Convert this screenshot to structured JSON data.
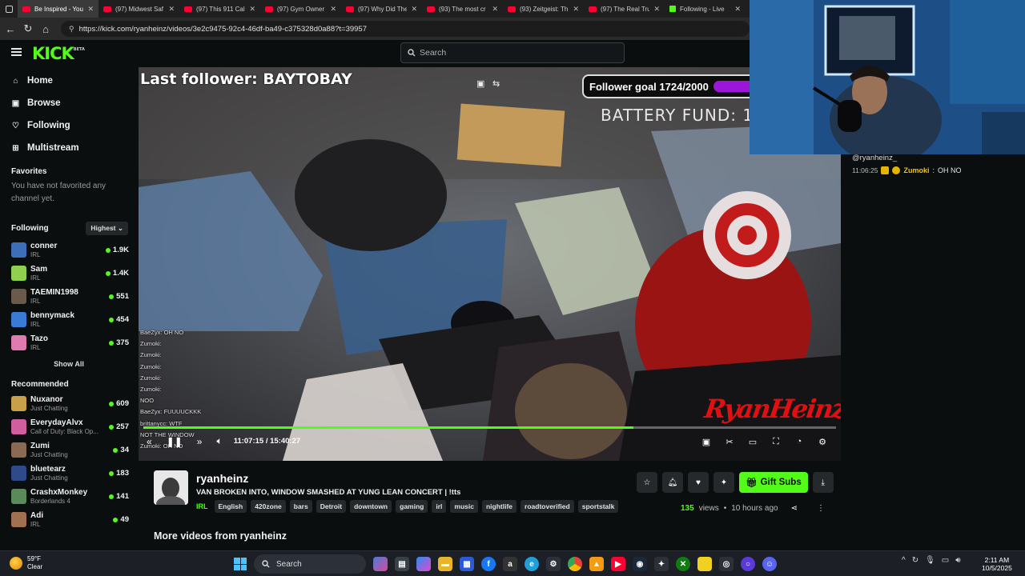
{
  "browser": {
    "tabs": [
      {
        "title": "Be Inspired - You",
        "icon": "youtube",
        "active": true
      },
      {
        "title": "(97) Midwest Saf",
        "icon": "youtube"
      },
      {
        "title": "(97) This 911 Cal",
        "icon": "youtube"
      },
      {
        "title": "(97) Gym Owner",
        "icon": "youtube"
      },
      {
        "title": "(97) Why Did The",
        "icon": "youtube"
      },
      {
        "title": "(93) The most cr",
        "icon": "youtube"
      },
      {
        "title": "(93) Zeitgeist: Th",
        "icon": "youtube"
      },
      {
        "title": "(97) The Real Tru",
        "icon": "youtube"
      },
      {
        "title": "Following - Live",
        "icon": "kick"
      }
    ],
    "url": "https://kick.com/ryanheinz/videos/3e2c9475-92c4-46df-ba49-c375328d0a88?t=39957"
  },
  "header": {
    "logo": "KICK",
    "logo_badge": "BETA",
    "search_placeholder": "Search"
  },
  "sidebar": {
    "nav": [
      {
        "label": "Home",
        "icon": "home-icon",
        "glyph": "⌂"
      },
      {
        "label": "Browse",
        "icon": "browse-icon",
        "glyph": "▣"
      },
      {
        "label": "Following",
        "icon": "heart-icon",
        "glyph": "♡"
      },
      {
        "label": "Multistream",
        "icon": "grid-icon",
        "glyph": "⊞"
      }
    ],
    "favorites_title": "Favorites",
    "favorites_empty": "You have not favorited any channel yet.",
    "following_title": "Following",
    "sort_label": "Highest",
    "following": [
      {
        "name": "conner",
        "category": "IRL",
        "viewers": "1.9K",
        "color": "#3d6fb8"
      },
      {
        "name": "Sam",
        "category": "IRL",
        "viewers": "1.4K",
        "color": "#8fd14f"
      },
      {
        "name": "TAEMIN1998",
        "category": "IRL",
        "viewers": "551",
        "color": "#6b5a4a"
      },
      {
        "name": "bennymack",
        "category": "IRL",
        "viewers": "454",
        "color": "#3a7bd5"
      },
      {
        "name": "Tazo",
        "category": "IRL",
        "viewers": "375",
        "color": "#e07bb0"
      }
    ],
    "show_all": "Show All",
    "recommended_title": "Recommended",
    "recommended": [
      {
        "name": "Nuxanor",
        "category": "Just Chatting",
        "viewers": "609",
        "color": "#c9a04a"
      },
      {
        "name": "EverydayAlvx",
        "category": "Call of Duty: Black Op...",
        "viewers": "257",
        "color": "#d15fa0"
      },
      {
        "name": "Zumi",
        "category": "Just Chatting",
        "viewers": "34",
        "color": "#8a6a52"
      },
      {
        "name": "bluetearz",
        "category": "Just Chatting",
        "viewers": "183",
        "color": "#2e4a8a"
      },
      {
        "name": "CrashxMonkey",
        "category": "Borderlands 4",
        "viewers": "141",
        "color": "#5a8a5a"
      },
      {
        "name": "Adi",
        "category": "IRL",
        "viewers": "49",
        "color": "#a07050"
      }
    ]
  },
  "video": {
    "overlay_left": "Last follower: BAYTOBAY",
    "goal_text": "Follower goal 1724/2000",
    "goal_progress": 0.862,
    "battery_text": "BATTERY FUND: 1",
    "watermark": "RyanHeinz",
    "chat_overlay": [
      "BaeZyx: OH NO",
      "Zumoki:",
      "Zumoki:",
      "Zumoki:",
      "Zumoki:",
      "Zumoki:",
      "NOO",
      "BaeZyx: FUUUUCKKK",
      "brittanycc: WTF",
      "NOT THE WINDOW",
      "Zumoki: OH NO"
    ],
    "current_time": "11:07:15",
    "duration": "15:40:27",
    "progress": 0.708
  },
  "chat": {
    "header_user": "@ryanheinz_",
    "message": {
      "time": "11:06:25",
      "user": "Zumoki",
      "text": "OH NO"
    }
  },
  "info": {
    "channel": "ryanheinz",
    "title": "VAN BROKEN INTO, WINDOW SMASHED AT YUNG LEAN CONCERT | !tts",
    "category": "IRL",
    "tags": [
      "English",
      "420zone",
      "bars",
      "Detroit",
      "downtown",
      "gaming",
      "irl",
      "music",
      "nightlife",
      "roadtoverified",
      "sportstalk"
    ],
    "gift_label": "Gift Subs",
    "views": "135",
    "views_label": "views",
    "age": "10 hours ago",
    "more_videos": "More videos from ryanheinz"
  },
  "taskbar": {
    "temp": "59°F",
    "weather": "Clear",
    "search_label": "Search",
    "time": "2:11 AM",
    "date": "10/5/2025"
  }
}
